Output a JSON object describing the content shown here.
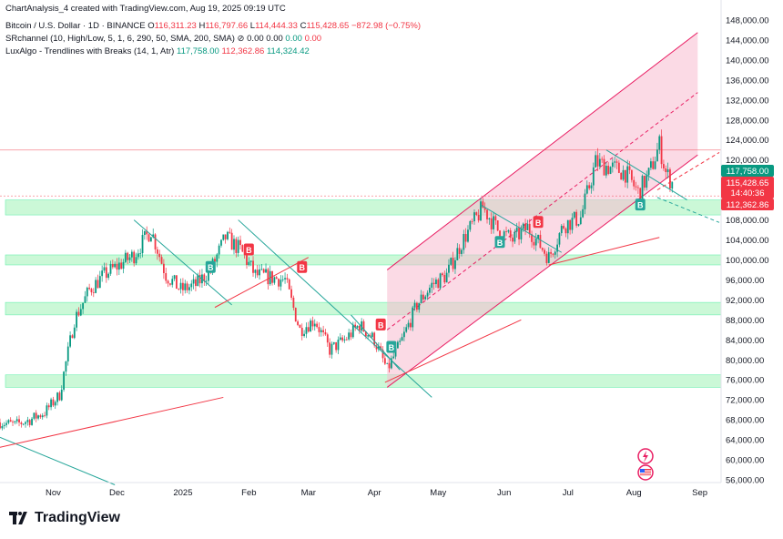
{
  "credit": "ChartAnalysis_4 created with TradingView.com, Aug 19, 2025 09:19 UTC",
  "header": {
    "symbol": "Bitcoin / U.S. Dollar · 1D · BINANCE",
    "open_label": "O",
    "open": "116,311.23",
    "high_label": "H",
    "high": "116,797.66",
    "low_label": "L",
    "low": "114,444.33",
    "close_label": "C",
    "close": "115,428.65",
    "change": "−872.98 (−0.75%)"
  },
  "indicators": {
    "srchannel": {
      "name": "SRchannel (10, High/Low, 5, 1, 6, 290, 50, SMA, 200, SMA)",
      "icon": "eye-slash-icon",
      "v1": "0.00",
      "v2": "0.00",
      "v3": "0.00",
      "v4": "0.00"
    },
    "luxalgo": {
      "name": "LuxAlgo - Trendlines with Breaks (14, 1, Atr)",
      "v1": "117,758.00",
      "v2": "112,362.86",
      "v3": "114,324.42"
    }
  },
  "price_badges": {
    "upper": "117,758.00",
    "last": "115,428.65",
    "countdown": "14:40:36",
    "lower": "112,362.86"
  },
  "brand": "TradingView",
  "colors": {
    "up": "#089981",
    "down": "#f23645",
    "channel_fill": "#f8bbd0",
    "sr_zone": "#b9f6ca",
    "trend_teal": "#26a69a",
    "trend_red": "#f23645",
    "channel_line": "#e91e63"
  },
  "chart_data": {
    "type": "candlestick",
    "ylim": [
      56000,
      148000
    ],
    "y_ticks": [
      56000,
      60000,
      64000,
      68000,
      72000,
      76000,
      80000,
      84000,
      88000,
      92000,
      96000,
      100000,
      104000,
      108000,
      112000,
      116000,
      120000,
      124000,
      128000,
      132000,
      136000,
      140000,
      144000,
      148000
    ],
    "y_tick_labels": [
      "56,000.00",
      "60,000.00",
      "64,000.00",
      "68,000.00",
      "72,000.00",
      "76,000.00",
      "80,000.00",
      "84,000.00",
      "88,000.00",
      "92,000.00",
      "96,000.00",
      "100,000.00",
      "104,000.00",
      "108,000.00",
      "112,000.00",
      "116,000.00",
      "120,000.00",
      "124,000.00",
      "128,000.00",
      "132,000.00",
      "136,000.00",
      "140,000.00",
      "144,000.00",
      "148,000.00"
    ],
    "x_range": [
      "2024-10-07",
      "2025-09-11"
    ],
    "months": [
      {
        "label": "Nov",
        "date": "2024-11-01"
      },
      {
        "label": "Dec",
        "date": "2024-12-01"
      },
      {
        "label": "2025",
        "date": "2025-01-01"
      },
      {
        "label": "Feb",
        "date": "2025-02-01"
      },
      {
        "label": "Mar",
        "date": "2025-03-01"
      },
      {
        "label": "Apr",
        "date": "2025-04-01"
      },
      {
        "label": "May",
        "date": "2025-05-01"
      },
      {
        "label": "Jun",
        "date": "2025-06-01"
      },
      {
        "label": "Jul",
        "date": "2025-07-01"
      },
      {
        "label": "Aug",
        "date": "2025-08-01"
      },
      {
        "label": "Sep",
        "date": "2025-09-01"
      }
    ],
    "path": [
      [
        "2024-10-07",
        67500
      ],
      [
        "2024-10-14",
        67000
      ],
      [
        "2024-10-21",
        68000
      ],
      [
        "2024-10-28",
        69500
      ],
      [
        "2024-11-04",
        73000
      ],
      [
        "2024-11-11",
        88000
      ],
      [
        "2024-11-18",
        94000
      ],
      [
        "2024-11-25",
        97000
      ],
      [
        "2024-12-02",
        99000
      ],
      [
        "2024-12-09",
        101000
      ],
      [
        "2024-12-17",
        106000
      ],
      [
        "2024-12-24",
        97000
      ],
      [
        "2024-12-31",
        94000
      ],
      [
        "2025-01-07",
        95000
      ],
      [
        "2025-01-14",
        98000
      ],
      [
        "2025-01-21",
        104500
      ],
      [
        "2025-01-28",
        102000
      ],
      [
        "2025-02-04",
        97000
      ],
      [
        "2025-02-11",
        96500
      ],
      [
        "2025-02-18",
        96000
      ],
      [
        "2025-02-25",
        86000
      ],
      [
        "2025-03-04",
        88000
      ],
      [
        "2025-03-11",
        82000
      ],
      [
        "2025-03-18",
        84000
      ],
      [
        "2025-03-25",
        87000
      ],
      [
        "2025-04-01",
        84000
      ],
      [
        "2025-04-07",
        78000
      ],
      [
        "2025-04-14",
        84000
      ],
      [
        "2025-04-21",
        91000
      ],
      [
        "2025-04-28",
        95000
      ],
      [
        "2025-05-05",
        97000
      ],
      [
        "2025-05-12",
        103500
      ],
      [
        "2025-05-22",
        110500
      ],
      [
        "2025-05-29",
        106000
      ],
      [
        "2025-06-05",
        104000
      ],
      [
        "2025-06-12",
        106500
      ],
      [
        "2025-06-22",
        100500
      ],
      [
        "2025-06-29",
        107000
      ],
      [
        "2025-07-07",
        108500
      ],
      [
        "2025-07-14",
        119500
      ],
      [
        "2025-07-21",
        118500
      ],
      [
        "2025-07-28",
        117500
      ],
      [
        "2025-08-03",
        113500
      ],
      [
        "2025-08-08",
        117000
      ],
      [
        "2025-08-13",
        123000
      ],
      [
        "2025-08-16",
        117500
      ],
      [
        "2025-08-19",
        115400
      ]
    ],
    "sr_zones": [
      [
        109000,
        112000
      ],
      [
        99000,
        101000
      ],
      [
        89000,
        91500
      ],
      [
        74500,
        77000
      ]
    ],
    "horizontal_lines": [
      122000,
      112800
    ],
    "channel": {
      "start": "2025-04-07",
      "end": "2025-08-31",
      "lower": [
        74500,
        121000
      ],
      "upper": [
        98000,
        145500
      ],
      "mid": [
        86000,
        133500
      ]
    },
    "trendlines": [
      {
        "color": "teal",
        "points": [
          [
            "2024-10-07",
            64500
          ],
          [
            "2024-11-30",
            55000
          ]
        ]
      },
      {
        "color": "red",
        "points": [
          [
            "2024-10-07",
            62500
          ],
          [
            "2025-01-20",
            72500
          ]
        ]
      },
      {
        "color": "teal",
        "points": [
          [
            "2024-12-09",
            108000
          ],
          [
            "2025-01-24",
            91000
          ]
        ]
      },
      {
        "color": "teal",
        "points": [
          [
            "2025-01-27",
            108000
          ],
          [
            "2025-04-28",
            72500
          ]
        ]
      },
      {
        "color": "teal",
        "points": [
          [
            "2025-03-21",
            89000
          ],
          [
            "2025-04-13",
            78000
          ]
        ]
      },
      {
        "color": "teal",
        "points": [
          [
            "2025-05-21",
            111000
          ],
          [
            "2025-06-28",
            101500
          ]
        ]
      },
      {
        "color": "teal",
        "points": [
          [
            "2025-07-19",
            122000
          ],
          [
            "2025-08-26",
            112000
          ]
        ]
      },
      {
        "color": "red",
        "points": [
          [
            "2025-01-16",
            90500
          ],
          [
            "2025-03-01",
            100500
          ]
        ]
      },
      {
        "color": "red",
        "points": [
          [
            "2025-04-06",
            75500
          ],
          [
            "2025-06-09",
            88000
          ]
        ]
      },
      {
        "color": "red",
        "points": [
          [
            "2025-06-22",
            99000
          ],
          [
            "2025-08-13",
            104500
          ]
        ]
      }
    ],
    "break_labels": [
      {
        "text": "B",
        "kind": "up",
        "date": "2025-01-14",
        "price": 98500
      },
      {
        "text": "B",
        "kind": "down",
        "date": "2025-02-01",
        "price": 102000
      },
      {
        "text": "B",
        "kind": "down",
        "date": "2025-02-26",
        "price": 98500
      },
      {
        "text": "B",
        "kind": "down",
        "date": "2025-04-04",
        "price": 87000
      },
      {
        "text": "B",
        "kind": "up",
        "date": "2025-04-09",
        "price": 82500
      },
      {
        "text": "B",
        "kind": "up",
        "date": "2025-05-30",
        "price": 103500
      },
      {
        "text": "B",
        "kind": "down",
        "date": "2025-06-17",
        "price": 107500
      },
      {
        "text": "B",
        "kind": "up",
        "date": "2025-08-04",
        "price": 111000
      }
    ]
  }
}
